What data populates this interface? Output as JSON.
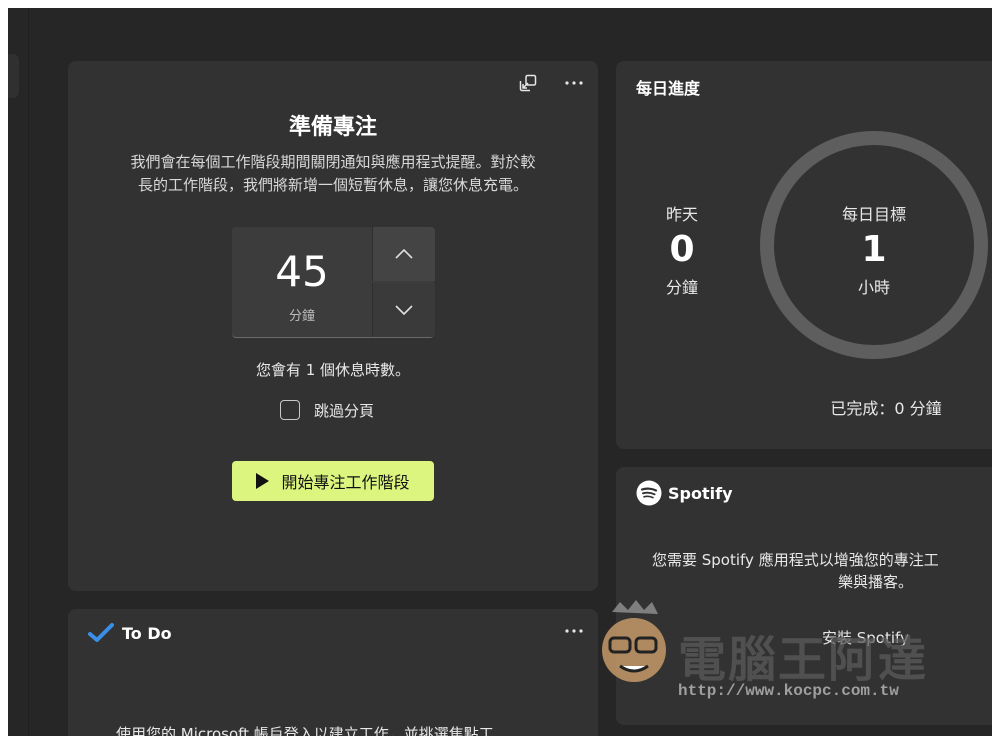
{
  "focus": {
    "title": "準備專注",
    "description_line1": "我們會在每個工作階段期間關閉通知與應用程式提醒。對於較",
    "description_line2": "長的工作階段，我們將新增一個短暫休息，讓您休息充電。",
    "minutes_value": "45",
    "minutes_unit": "分鐘",
    "break_info": "您會有 1 個休息時數。",
    "skip_break_label": "跳過分頁",
    "start_button_label": "開始專注工作階段"
  },
  "progress": {
    "title": "每日進度",
    "yesterday_label": "昨天",
    "yesterday_value": "0",
    "yesterday_unit": "分鐘",
    "goal_label": "每日目標",
    "goal_value": "1",
    "goal_unit": "小時",
    "completed_text": "已完成：0 分鐘"
  },
  "spotify": {
    "brand": "Spotify",
    "message_line1": "您需要 Spotify 應用程式以增強您的專注工",
    "message_line2": "樂與播客。",
    "install_label": "安裝 Spotify"
  },
  "todo": {
    "title": "To Do",
    "message": "使用您的 Microsoft 帳戶登入以建立工作，並挑選焦點工"
  },
  "watermark": {
    "text": "電腦王阿達",
    "url": "http://www.kocpc.com.tw"
  },
  "colors": {
    "background": "#262626",
    "card": "#323232",
    "accent": "#dcf57e",
    "ring": "#5e5e5e"
  }
}
